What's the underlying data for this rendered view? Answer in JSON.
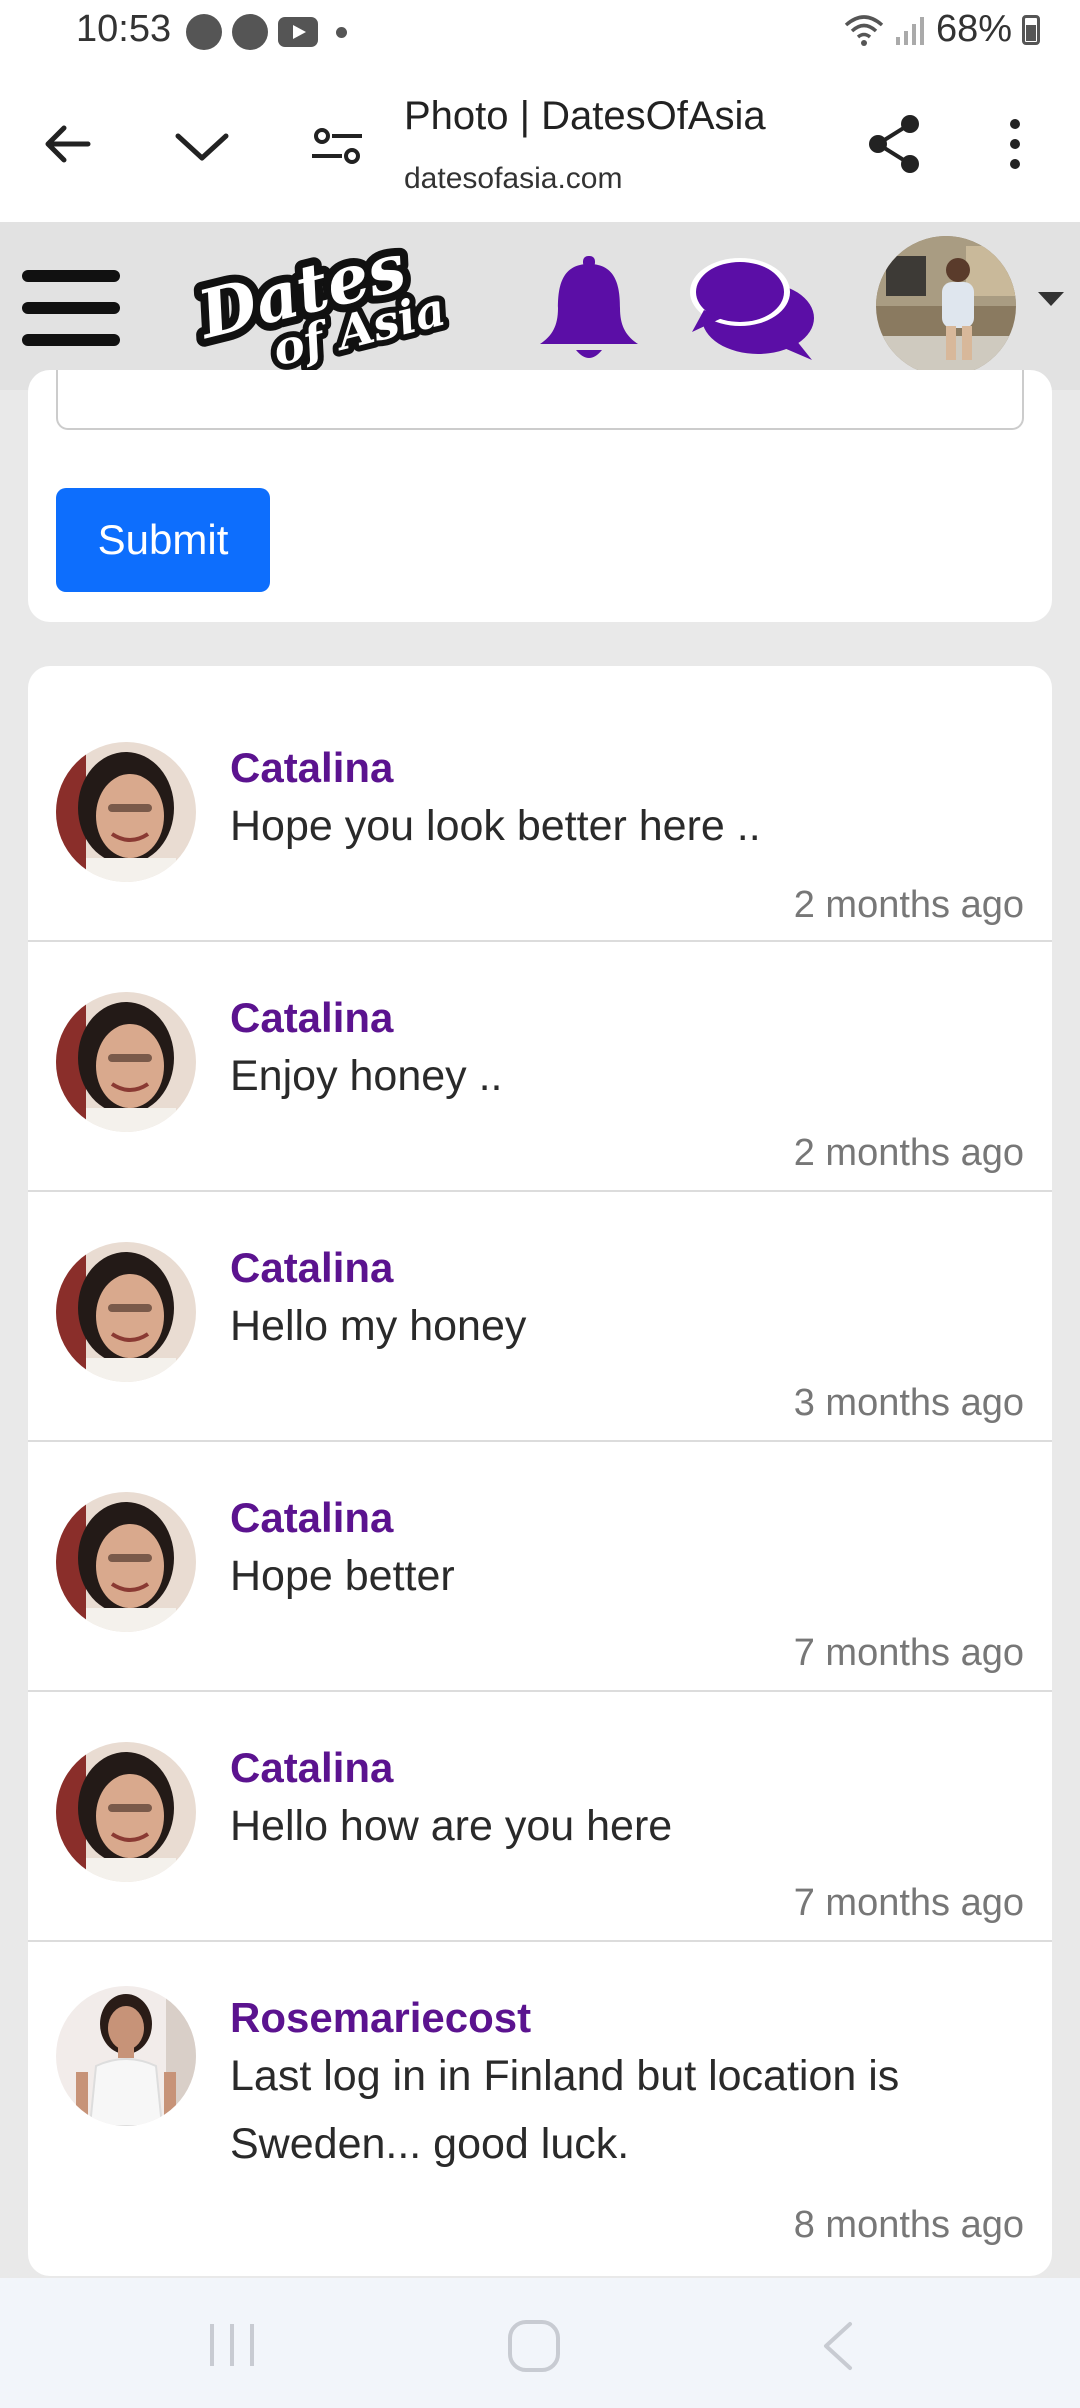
{
  "status_bar": {
    "time": "10:53",
    "battery": "68%",
    "icons": [
      "home-icon",
      "home-icon",
      "youtube-icon",
      "dot-icon",
      "wifi-icon",
      "signal-icon",
      "battery-icon"
    ]
  },
  "browser": {
    "page_title": "Photo | DatesOfAsia",
    "domain": "datesofasia.com",
    "icons": [
      "back-arrow-icon",
      "chevron-down-icon",
      "tune-icon",
      "share-icon",
      "more-vert-icon"
    ]
  },
  "site_header": {
    "logo_alt": "Dates of Asia",
    "accent_color": "#5b0ea6",
    "icons": [
      "menu-icon",
      "bell-icon",
      "chat-icon",
      "caret-down-icon"
    ]
  },
  "form": {
    "submit_label": "Submit"
  },
  "comments": [
    {
      "name": "Catalina",
      "text": "Hope you look better here ..",
      "time": "2 months ago"
    },
    {
      "name": "Catalina",
      "text": "Enjoy honey ..",
      "time": "2 months ago"
    },
    {
      "name": "Catalina",
      "text": "Hello my honey",
      "time": "3 months ago"
    },
    {
      "name": "Catalina",
      "text": "Hope better",
      "time": "7 months ago"
    },
    {
      "name": "Catalina",
      "text": "Hello how are you here",
      "time": "7 months ago"
    },
    {
      "name": "Rosemariecost",
      "text": "Last log in in Finland but location is Sweden... good luck.",
      "time": "8 months ago"
    }
  ],
  "colors": {
    "name_color": "#5b138f",
    "button_color": "#0d6efd"
  }
}
